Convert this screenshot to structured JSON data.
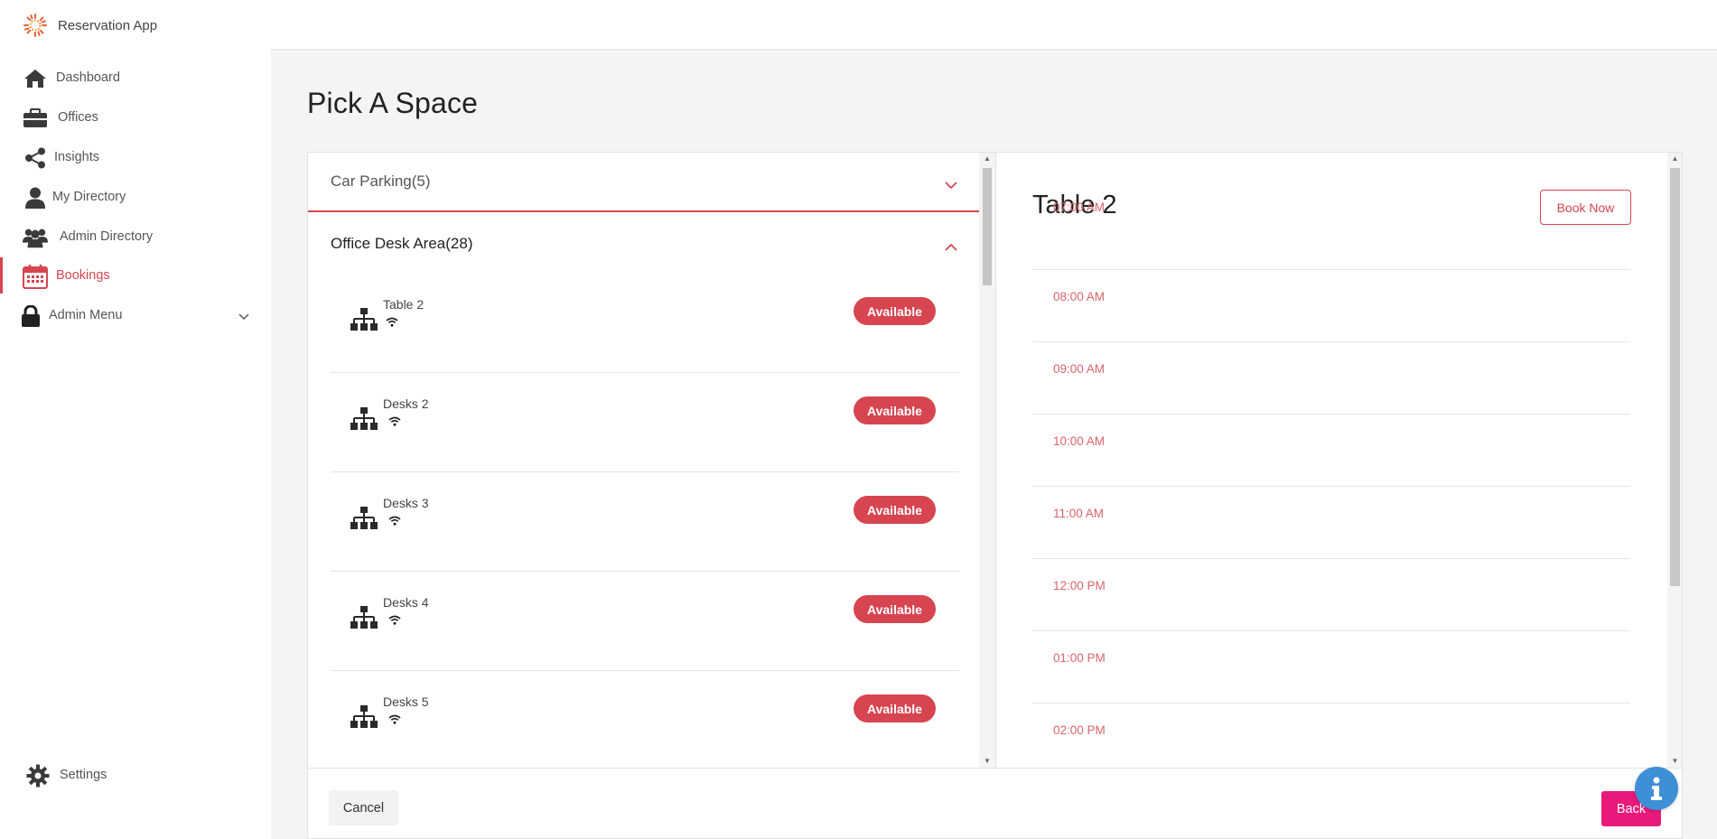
{
  "app": {
    "name": "Reservation App",
    "accent_color": "#d64550",
    "logo_icon": "sunburst-logo"
  },
  "sidebar": {
    "items": [
      {
        "label": "Dashboard",
        "icon": "home-icon"
      },
      {
        "label": "Offices",
        "icon": "briefcase-icon"
      },
      {
        "label": "Insights",
        "icon": "share-icon"
      },
      {
        "label": "My Directory",
        "icon": "user-icon"
      },
      {
        "label": "Admin Directory",
        "icon": "users-icon"
      },
      {
        "label": "Bookings",
        "icon": "calendar-icon",
        "active": true
      },
      {
        "label": "Admin Menu",
        "icon": "lock-icon",
        "expandable": true
      }
    ],
    "settings": {
      "label": "Settings",
      "icon": "gear-icon"
    }
  },
  "page": {
    "title": "Pick A Space"
  },
  "spaces": {
    "groups": [
      {
        "label": "Car Parking(5)",
        "expanded": false
      },
      {
        "label": "Office Desk Area(28)",
        "expanded": true
      }
    ],
    "desks": [
      {
        "name": "Table 2",
        "status": "Available"
      },
      {
        "name": "Desks 2",
        "status": "Available"
      },
      {
        "name": "Desks 3",
        "status": "Available"
      },
      {
        "name": "Desks 4",
        "status": "Available"
      },
      {
        "name": "Desks 5",
        "status": "Available"
      }
    ]
  },
  "detail": {
    "title": "Table 2",
    "book_label": "Book Now",
    "time_slots": [
      "07:00 AM",
      "08:00 AM",
      "09:00 AM",
      "10:00 AM",
      "11:00 AM",
      "12:00 PM",
      "01:00 PM",
      "02:00 PM"
    ]
  },
  "footer": {
    "cancel_label": "Cancel",
    "back_label": "Back",
    "back_color": "#e8197b"
  }
}
